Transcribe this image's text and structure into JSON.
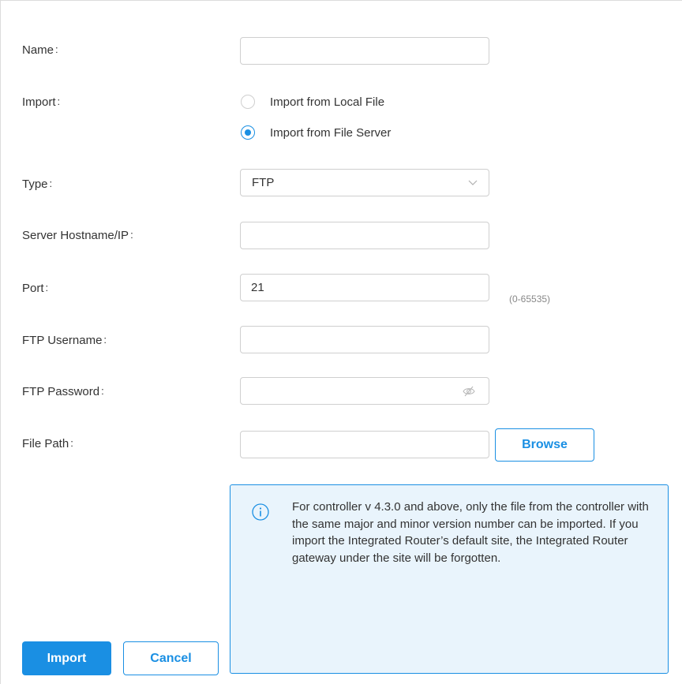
{
  "form": {
    "name": {
      "label": "Name",
      "value": ""
    },
    "import": {
      "label": "Import",
      "options": [
        {
          "label": "Import from Local File",
          "selected": false
        },
        {
          "label": "Import from File Server",
          "selected": true
        }
      ]
    },
    "type": {
      "label": "Type",
      "value": "FTP"
    },
    "server_hostname": {
      "label": "Server Hostname/IP",
      "value": ""
    },
    "port": {
      "label": "Port",
      "value": "21",
      "hint": "(0-65535)"
    },
    "ftp_username": {
      "label": "FTP Username",
      "value": ""
    },
    "ftp_password": {
      "label": "FTP Password",
      "value": ""
    },
    "file_path": {
      "label": "File Path",
      "value": "",
      "browse_label": "Browse"
    },
    "colon": ":"
  },
  "info": {
    "icon": "info-icon",
    "text": "For controller v 4.3.0 and above, only the file from the controller with the same major and minor version number can be imported. If you import the Integrated Router’s default site, the Integrated Router gateway under the site will be forgotten."
  },
  "actions": {
    "import_label": "Import",
    "cancel_label": "Cancel"
  },
  "colors": {
    "accent": "#1a8fe3",
    "info_background": "#e9f4fc"
  }
}
